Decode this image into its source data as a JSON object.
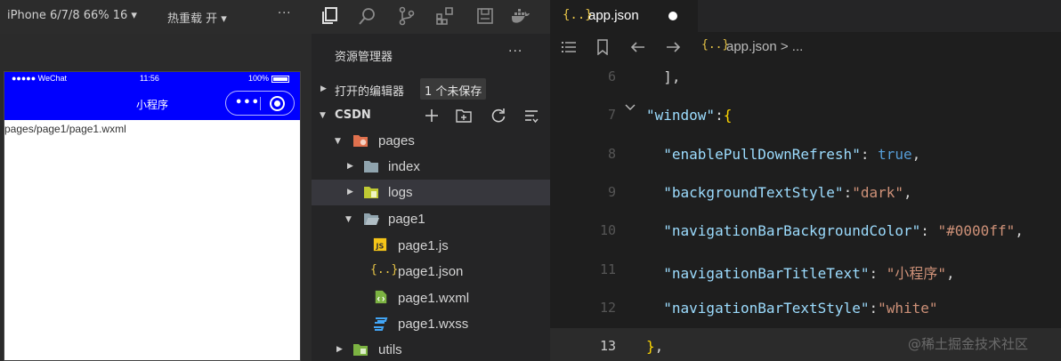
{
  "simulator": {
    "device_label": "iPhone 6/7/8 66% 16 ▾",
    "reload_label": "热重载 开 ▾",
    "more_label": "···",
    "status": {
      "carrier": "●●●●● WeChat",
      "time": "11:56",
      "battery": "100%"
    },
    "nav_title": "小程序",
    "nav_bg": "#0000ff",
    "capsule_dots": "•••",
    "page_text": "pages/page1/page1.wxml"
  },
  "explorer": {
    "title": "资源管理器",
    "more_label": "···",
    "open_editors_label": "打开的编辑器",
    "unsaved_badge": "1 个未保存",
    "section_label": "CSDN",
    "activity_icons": [
      "files-icon",
      "search-icon",
      "source-control-icon",
      "extensions-icon",
      "debug-icon",
      "docker-icon"
    ],
    "tree": [
      {
        "label": "pages",
        "icon": "folder-open-icon",
        "twisty": "down"
      },
      {
        "label": "index",
        "icon": "folder-icon",
        "twisty": "right"
      },
      {
        "label": "logs",
        "icon": "folder-icon",
        "twisty": "right"
      },
      {
        "label": "page1",
        "icon": "folder-open-icon",
        "twisty": "down"
      },
      {
        "label": "page1.js",
        "icon": "js-file-icon",
        "twisty": ""
      },
      {
        "label": "page1.json",
        "icon": "json-file-icon",
        "twisty": ""
      },
      {
        "label": "page1.wxml",
        "icon": "wxml-file-icon",
        "twisty": ""
      },
      {
        "label": "page1.wxss",
        "icon": "wxss-file-icon",
        "twisty": ""
      },
      {
        "label": "utils",
        "icon": "folder-icon",
        "twisty": "right"
      }
    ]
  },
  "editor": {
    "tab_icon": "{..}",
    "tab_name": "app.json",
    "breadcrumb_icon": "{..}",
    "breadcrumb": "app.json > ...",
    "lines": [
      {
        "num": "6",
        "tokens": [
          [
            "p",
            "  ],"
          ]
        ]
      },
      {
        "num": "7",
        "tokens": [
          [
            "k",
            "\"window\""
          ],
          [
            "p",
            ":"
          ],
          [
            "y",
            "{"
          ]
        ]
      },
      {
        "num": "8",
        "tokens": [
          [
            "k",
            "  \"enablePullDownRefresh\""
          ],
          [
            "p",
            ": "
          ],
          [
            "b",
            "true"
          ],
          [
            "p",
            ","
          ]
        ]
      },
      {
        "num": "9",
        "tokens": [
          [
            "k",
            "  \"backgroundTextStyle\""
          ],
          [
            "p",
            ":"
          ],
          [
            "s",
            "\"dark\""
          ],
          [
            "p",
            ","
          ]
        ]
      },
      {
        "num": "10",
        "tokens": [
          [
            "k",
            "  \"navigationBarBackgroundColor\""
          ],
          [
            "p",
            ": "
          ],
          [
            "s",
            "\"#0000ff\""
          ],
          [
            "p",
            ","
          ]
        ]
      },
      {
        "num": "11",
        "tokens": [
          [
            "k",
            "  \"navigationBarTitleText\""
          ],
          [
            "p",
            ": "
          ],
          [
            "s",
            "\"小程序\""
          ],
          [
            "p",
            ","
          ]
        ]
      },
      {
        "num": "12",
        "tokens": [
          [
            "k",
            "  \"navigationBarTextStyle\""
          ],
          [
            "p",
            ":"
          ],
          [
            "s",
            "\"white\""
          ]
        ]
      },
      {
        "num": "13",
        "tokens": [
          [
            "y",
            "}"
          ],
          [
            "p",
            ","
          ]
        ]
      }
    ],
    "current_line": "13"
  },
  "watermark": "@稀土掘金技术社区"
}
